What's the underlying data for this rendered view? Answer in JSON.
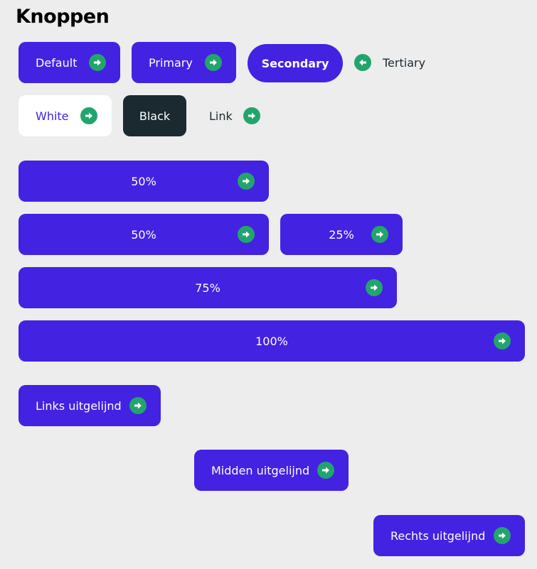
{
  "page": {
    "title": "Knoppen"
  },
  "row1": {
    "default_label": "Default",
    "primary_label": "Primary",
    "secondary_label": "Secondary",
    "tertiary_label": "Tertiary"
  },
  "row2": {
    "white_label": "White",
    "black_label": "Black",
    "link_label": "Link"
  },
  "widths": {
    "w50a_label": "50%",
    "w50b_label": "50%",
    "w25_label": "25%",
    "w75_label": "75%",
    "w100_label": "100%"
  },
  "alignment": {
    "left_label": "Links uitgelijnd",
    "center_label": "Midden uitgelijnd",
    "right_label": "Rechts uitgelijnd"
  },
  "colors": {
    "primary": "#4322e2",
    "icon_bg": "#22a56d",
    "black_button": "#1b2a31",
    "background": "#ededed"
  },
  "icons": {
    "arrow": "arrow-right-icon",
    "arrow_back": "arrow-left-icon"
  }
}
